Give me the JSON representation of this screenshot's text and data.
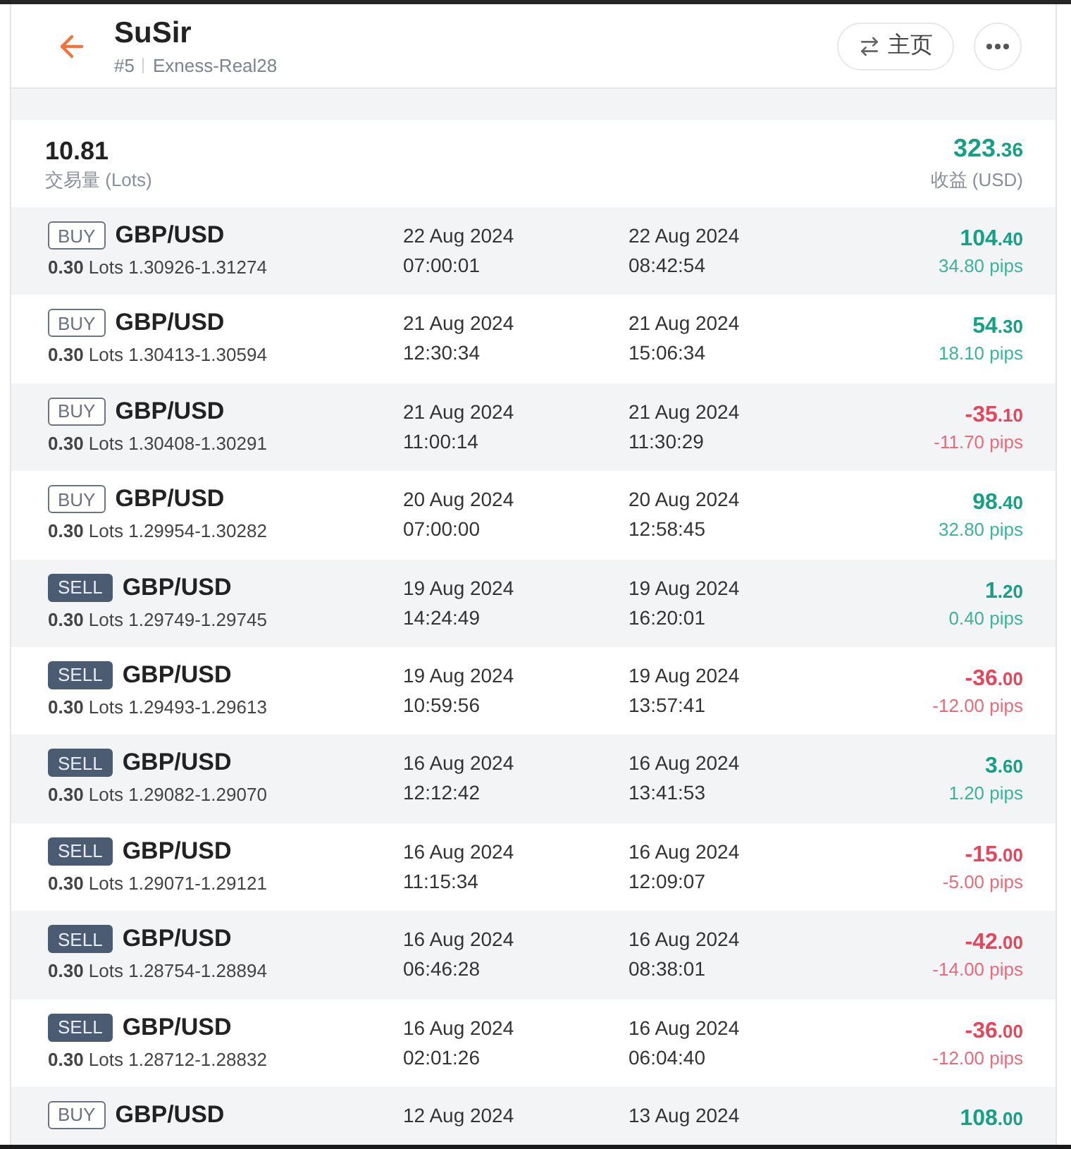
{
  "header": {
    "title": "SuSir",
    "rank": "#5",
    "server": "Exness-Real28",
    "home_button": "主页"
  },
  "summary": {
    "volume": "10.81",
    "volume_label": "交易量 (Lots)",
    "profit": "323.36",
    "profit_label": "收益 (USD)",
    "loss": false
  },
  "trades": [
    {
      "kind": "buy",
      "side": "BUY",
      "pair": "GBP/USD",
      "lots": "**0.30** Lots 1.30926-1.31274",
      "open": {
        "date": "22 Aug 2024",
        "time": "07:00:01"
      },
      "close": {
        "date": "22 Aug 2024",
        "time": "08:42:54"
      },
      "profit": "104.40",
      "pips": "34.80 pips",
      "loss": false
    },
    {
      "kind": "buy",
      "side": "BUY",
      "pair": "GBP/USD",
      "lots": "**0.30** Lots 1.30413-1.30594",
      "open": {
        "date": "21 Aug 2024",
        "time": "12:30:34"
      },
      "close": {
        "date": "21 Aug 2024",
        "time": "15:06:34"
      },
      "profit": "54.30",
      "pips": "18.10 pips",
      "loss": false
    },
    {
      "kind": "buy",
      "side": "BUY",
      "pair": "GBP/USD",
      "lots": "**0.30** Lots 1.30408-1.30291",
      "open": {
        "date": "21 Aug 2024",
        "time": "11:00:14"
      },
      "close": {
        "date": "21 Aug 2024",
        "time": "11:30:29"
      },
      "profit": "-35.10",
      "pips": "-11.70 pips",
      "loss": true
    },
    {
      "kind": "buy",
      "side": "BUY",
      "pair": "GBP/USD",
      "lots": "**0.30** Lots 1.29954-1.30282",
      "open": {
        "date": "20 Aug 2024",
        "time": "07:00:00"
      },
      "close": {
        "date": "20 Aug 2024",
        "time": "12:58:45"
      },
      "profit": "98.40",
      "pips": "32.80 pips",
      "loss": false
    },
    {
      "kind": "sell",
      "side": "SELL",
      "pair": "GBP/USD",
      "lots": "**0.30** Lots 1.29749-1.29745",
      "open": {
        "date": "19 Aug 2024",
        "time": "14:24:49"
      },
      "close": {
        "date": "19 Aug 2024",
        "time": "16:20:01"
      },
      "profit": "1.20",
      "pips": "0.40 pips",
      "loss": false
    },
    {
      "kind": "sell",
      "side": "SELL",
      "pair": "GBP/USD",
      "lots": "**0.30** Lots 1.29493-1.29613",
      "open": {
        "date": "19 Aug 2024",
        "time": "10:59:56"
      },
      "close": {
        "date": "19 Aug 2024",
        "time": "13:57:41"
      },
      "profit": "-36.00",
      "pips": "-12.00 pips",
      "loss": true
    },
    {
      "kind": "sell",
      "side": "SELL",
      "pair": "GBP/USD",
      "lots": "**0.30** Lots 1.29082-1.29070",
      "open": {
        "date": "16 Aug 2024",
        "time": "12:12:42"
      },
      "close": {
        "date": "16 Aug 2024",
        "time": "13:41:53"
      },
      "profit": "3.60",
      "pips": "1.20 pips",
      "loss": false
    },
    {
      "kind": "sell",
      "side": "SELL",
      "pair": "GBP/USD",
      "lots": "**0.30** Lots 1.29071-1.29121",
      "open": {
        "date": "16 Aug 2024",
        "time": "11:15:34"
      },
      "close": {
        "date": "16 Aug 2024",
        "time": "12:09:07"
      },
      "profit": "-15.00",
      "pips": "-5.00 pips",
      "loss": true
    },
    {
      "kind": "sell",
      "side": "SELL",
      "pair": "GBP/USD",
      "lots": "**0.30** Lots 1.28754-1.28894",
      "open": {
        "date": "16 Aug 2024",
        "time": "06:46:28"
      },
      "close": {
        "date": "16 Aug 2024",
        "time": "08:38:01"
      },
      "profit": "-42.00",
      "pips": "-14.00 pips",
      "loss": true
    },
    {
      "kind": "sell",
      "side": "SELL",
      "pair": "GBP/USD",
      "lots": "**0.30** Lots 1.28712-1.28832",
      "open": {
        "date": "16 Aug 2024",
        "time": "02:01:26"
      },
      "close": {
        "date": "16 Aug 2024",
        "time": "06:04:40"
      },
      "profit": "-36.00",
      "pips": "-12.00 pips",
      "loss": true
    },
    {
      "kind": "buy",
      "side": "BUY",
      "pair": "GBP/USD",
      "open": {
        "date": "12 Aug 2024"
      },
      "close": {
        "date": "13 Aug 2024"
      },
      "profit": "108.00",
      "loss": false
    }
  ]
}
